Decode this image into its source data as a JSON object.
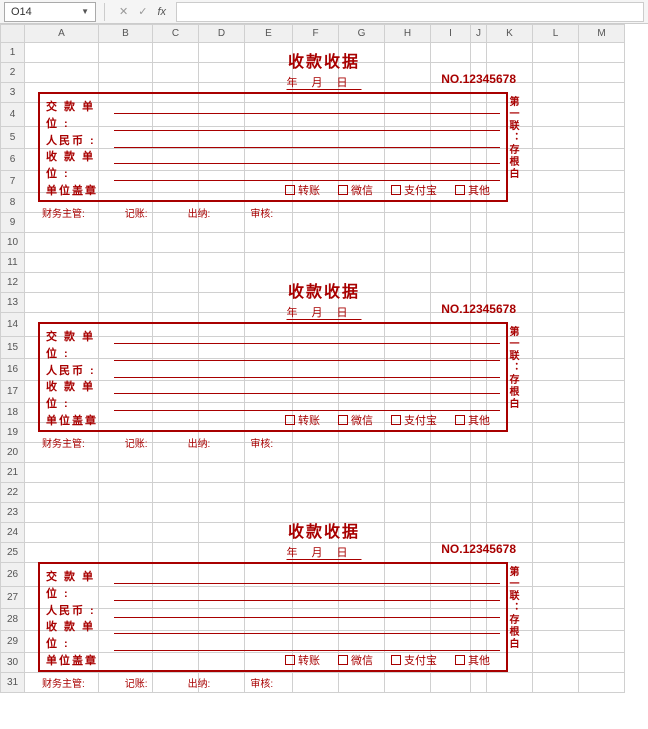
{
  "formula_bar": {
    "cell_ref": "O14",
    "cancel": "✕",
    "confirm": "✓",
    "fx": "fx",
    "value": ""
  },
  "columns": [
    "A",
    "B",
    "C",
    "D",
    "E",
    "F",
    "G",
    "H",
    "I",
    "J",
    "K",
    "L",
    "M"
  ],
  "rows": [
    "1",
    "2",
    "3",
    "4",
    "5",
    "6",
    "7",
    "8",
    "9",
    "10",
    "11",
    "12",
    "13",
    "14",
    "15",
    "16",
    "17",
    "18",
    "19",
    "20",
    "21",
    "22",
    "23",
    "24",
    "25",
    "26",
    "27",
    "28",
    "29",
    "30",
    "31"
  ],
  "receipt": {
    "title": "收款收据",
    "serial_prefix": "NO.",
    "serial": "12345678",
    "year": "年",
    "month": "月",
    "day": "日",
    "label_payer1": "交 款 单",
    "label_payer2": "位 :",
    "label_rmb": "人民币 :",
    "label_recv1": "收 款 单",
    "label_recv2": "位 :",
    "label_seal": "单位盖章",
    "pay_transfer": "转账",
    "pay_wechat": "微信",
    "pay_alipay": "支付宝",
    "pay_other": "其他",
    "side_text": "第一联：存根白",
    "sign_mgr": "财务主管:",
    "sign_book": "记账:",
    "sign_cash": "出纳:",
    "sign_audit": "审核:"
  }
}
